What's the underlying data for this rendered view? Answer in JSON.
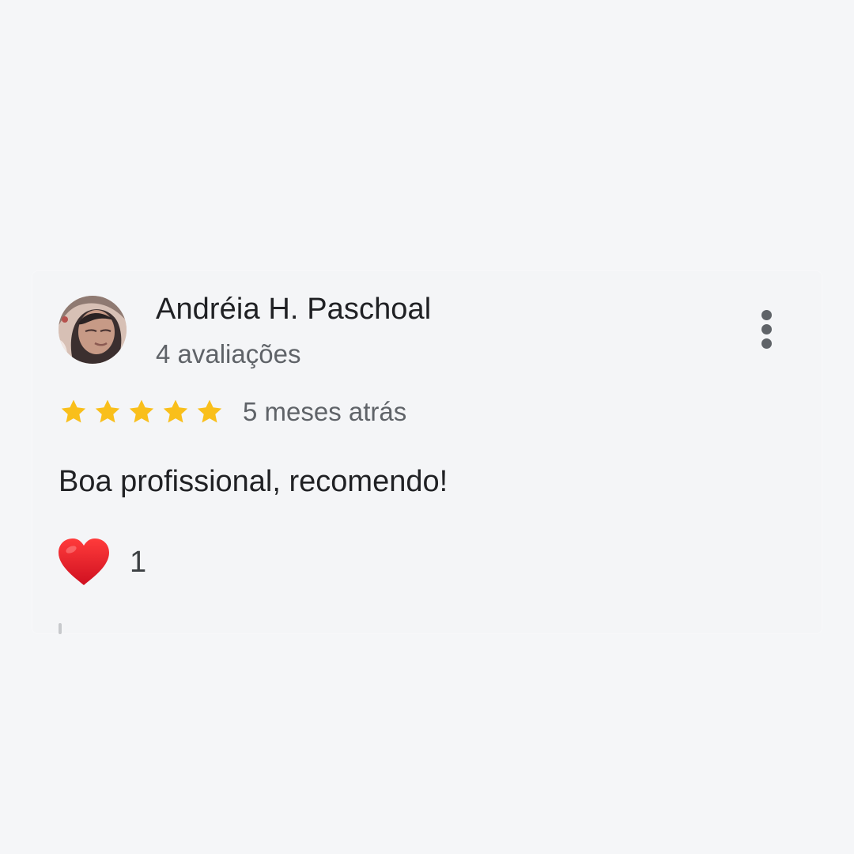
{
  "review": {
    "reviewer_name": "Andréia H. Paschoal",
    "review_count_label": "4 avaliações",
    "rating": 5,
    "rating_max": 5,
    "date_label": "5 meses atrás",
    "text": "Boa profissional, recomendo!",
    "reaction_count": "1"
  },
  "icons": {
    "avatar": "avatar-photo",
    "menu": "more-vertical-icon",
    "star": "star-icon",
    "reaction": "heart-icon"
  },
  "colors": {
    "background": "#f5f6f8",
    "star": "#f9bf1b",
    "heart": "#e61e2c",
    "primary_text": "#202124",
    "secondary_text": "#5f6368"
  }
}
